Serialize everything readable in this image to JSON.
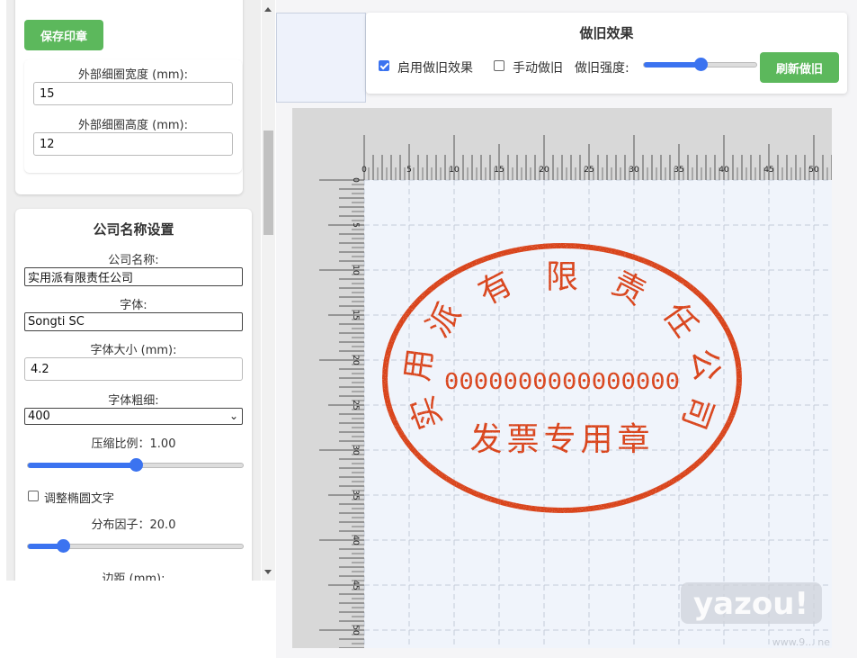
{
  "left_panel": {
    "save_button": "保存印章",
    "outer_width_label": "外部细圈宽度 (mm):",
    "outer_width_value": "15",
    "outer_height_label": "外部细圈高度 (mm):",
    "outer_height_value": "12",
    "company_section_title": "公司名称设置",
    "company_name_label": "公司名称:",
    "company_name_value": "实用派有限责任公司",
    "font_label": "字体:",
    "font_value": "Songti SC",
    "font_size_label": "字体大小 (mm):",
    "font_size_value": "4.2",
    "font_weight_label": "字体粗细:",
    "font_weight_value": "400",
    "compress_label": "压缩比例：1.00",
    "compress_level": 0.5,
    "adjust_ellipse_label": "调整椭圆文字",
    "adjust_ellipse_checked": false,
    "distribution_label": "分布因子：20.0",
    "distribution_level": 0.14,
    "margin_label": "边距 (mm):"
  },
  "effects": {
    "title": "做旧效果",
    "enable_label": "启用做旧效果",
    "enable_checked": true,
    "manual_label": "手动做旧",
    "strength_label": "做旧强度:",
    "strength_level": 0.5,
    "refresh_button": "刷新做旧"
  },
  "ruler": {
    "top_ticks": [
      "0",
      "5",
      "10",
      "15",
      "20",
      "25",
      "30",
      "35",
      "40",
      "45",
      "50"
    ],
    "left_ticks": [
      "0",
      "5",
      "10",
      "15",
      "20",
      "25",
      "30",
      "35",
      "40",
      "45",
      "50"
    ]
  },
  "stamp": {
    "color": "#d9441f",
    "top_text": "实用派有限责任公司",
    "number": "0000000000000000",
    "bottom_text": "发票专用章"
  },
  "watermark": {
    "text": "yazou!",
    "corner_text": "www.9... ne"
  },
  "colors": {
    "accent_green": "#5cb85c",
    "slider_blue": "#3b73f0"
  }
}
